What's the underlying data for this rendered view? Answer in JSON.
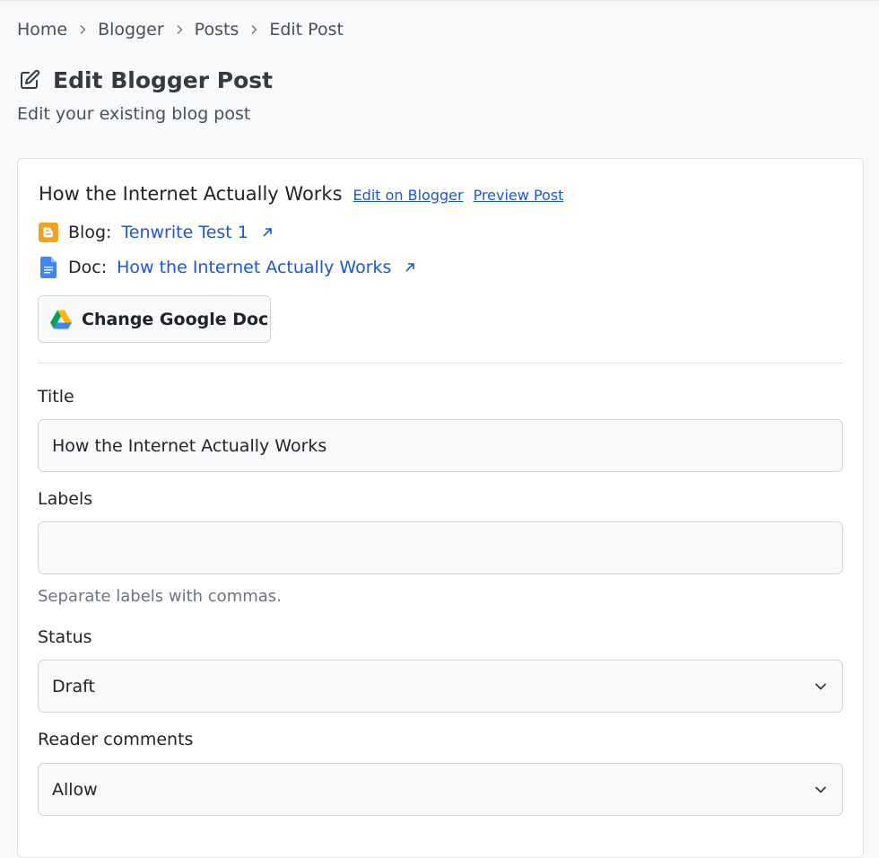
{
  "breadcrumb": {
    "items": [
      "Home",
      "Blogger",
      "Posts",
      "Edit Post"
    ]
  },
  "page": {
    "title": "Edit Blogger Post",
    "subtitle": "Edit your existing blog post",
    "title_icon": "edit-icon"
  },
  "post": {
    "title": "How the Internet Actually Works",
    "edit_link": "Edit on Blogger",
    "preview_link": "Preview Post",
    "blog_label": "Blog:",
    "blog_name": "Tenwrite Test 1",
    "doc_label": "Doc:",
    "doc_name": "How the Internet Actually Works",
    "change_doc_button": "Change Google Doc"
  },
  "form": {
    "title_label": "Title",
    "title_value": "How the Internet Actually Works",
    "labels_label": "Labels",
    "labels_value": "",
    "labels_help": "Separate labels with commas.",
    "status_label": "Status",
    "status_value": "Draft",
    "comments_label": "Reader comments",
    "comments_value": "Allow"
  },
  "colors": {
    "link": "#1a56db",
    "blogger_orange": "#f4a21d",
    "docs_blue": "#4285f4"
  }
}
